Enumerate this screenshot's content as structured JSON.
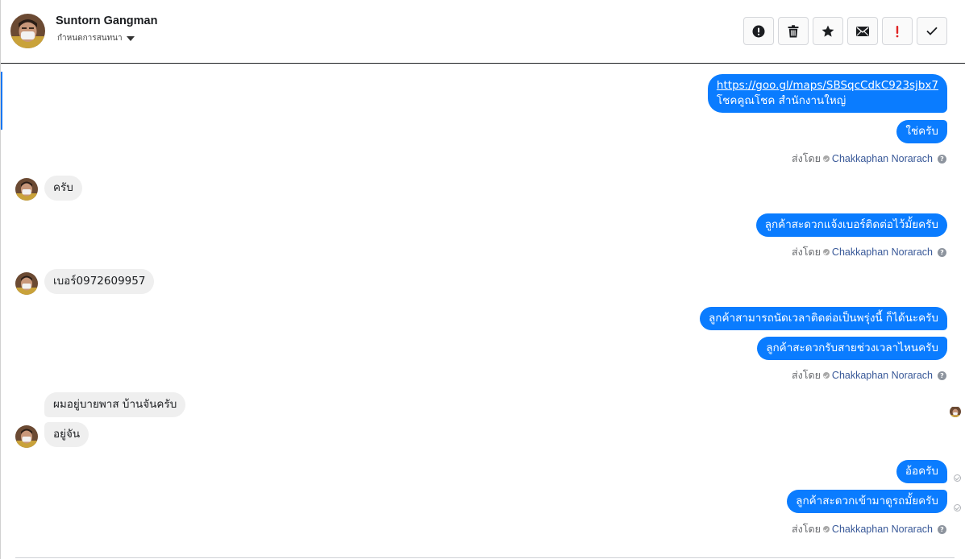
{
  "header": {
    "contact_name": "Suntorn Gangman",
    "status_label": "กำหนดการสนทนา"
  },
  "toolbar": {
    "buttons": [
      {
        "name": "spam-button",
        "icon": "alert-circle-icon"
      },
      {
        "name": "delete-button",
        "icon": "trash-icon"
      },
      {
        "name": "star-button",
        "icon": "star-icon"
      },
      {
        "name": "mark-unread-button",
        "icon": "envelope-icon"
      },
      {
        "name": "priority-button",
        "icon": "exclamation-icon"
      },
      {
        "name": "mark-done-button",
        "icon": "checkmark-icon"
      }
    ]
  },
  "colors": {
    "outgoing_bubble": "#0a7cff",
    "incoming_bubble": "#efefef",
    "priority_red": "#e02424",
    "agent_link": "#385898"
  },
  "messages": {
    "m1_link": "https://goo.gl/maps/SBSqcCdkC923sjbx7",
    "m1_text": "โชคคูณโชค สำนักงานใหญ่",
    "m2": "ใช่ครับ",
    "m3": "ครับ",
    "m4": "ลูกค้าสะดวกแจ้งเบอร์ติดต่อไว้มั้ยครับ",
    "m5": "เบอร์0972609957",
    "m6": "ลูกค้าสามารถนัดเวลาติดต่อเป็นพรุ่งนี้ ก็ได้นะครับ",
    "m7": "ลูกค้าสะดวกรับสายช่วงเวลาไหนครับ",
    "m8": "ผมอยู่บายพาส บ้านจันครับ",
    "m9": "อยู่จัน",
    "m10": "อ้อครับ",
    "m11": "ลูกค้าสะดวกเข้ามาดูรถมั้ยครับ"
  },
  "sent_by": {
    "prefix": "ส่งโดย",
    "agent": "Chakkaphan Norarach",
    "help": "?"
  }
}
